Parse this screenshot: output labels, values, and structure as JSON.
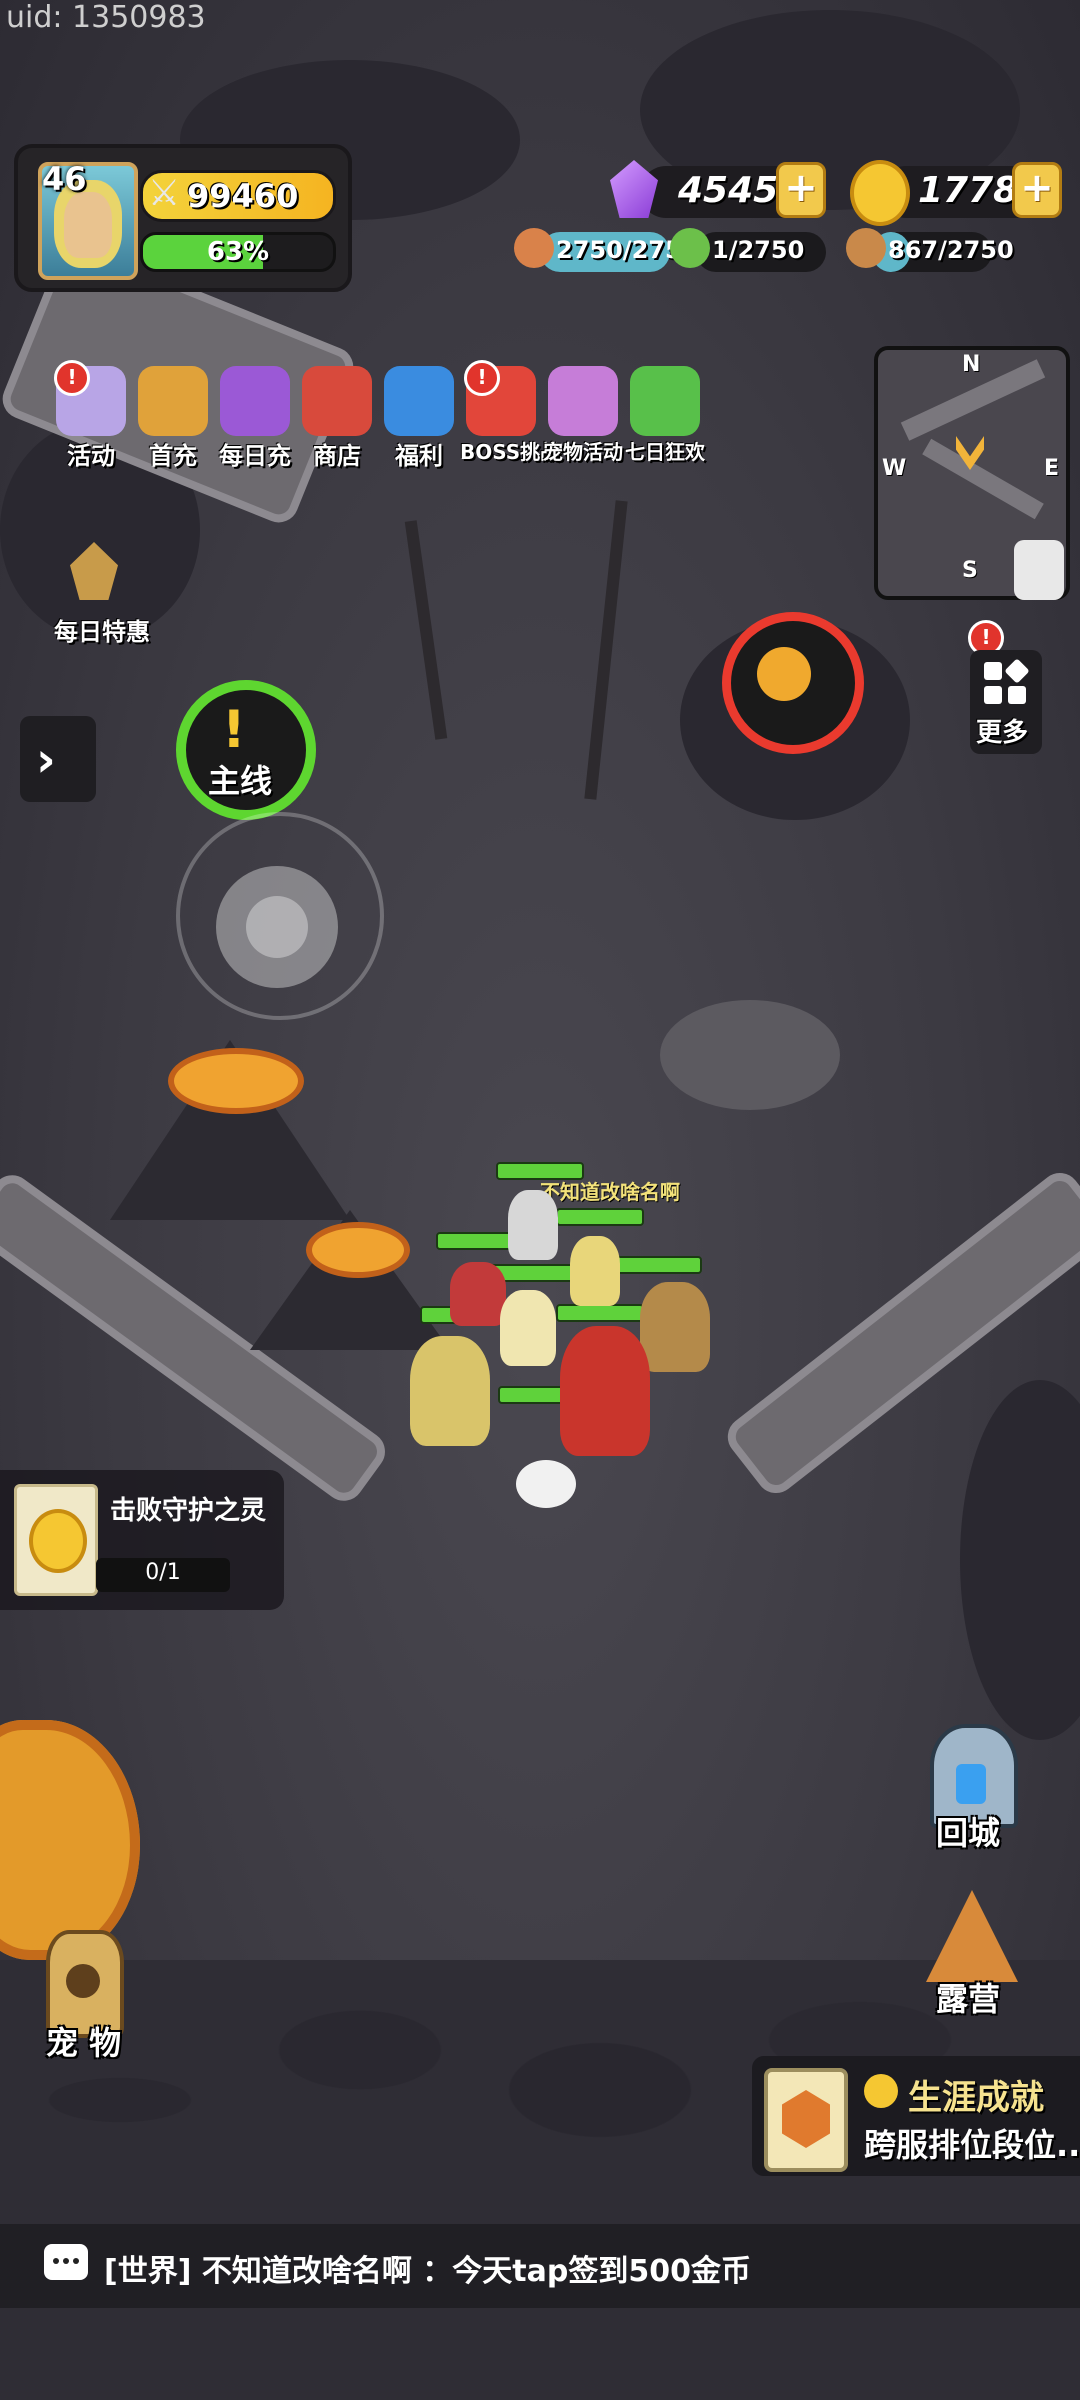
{
  "uid": "uid: 1350983",
  "player": {
    "level": "46",
    "power": "99460",
    "xp_percent": "63%",
    "xp_fraction": 0.63
  },
  "currencies": {
    "gems": "4545",
    "gold": "1778"
  },
  "resources": [
    {
      "name": "meat-icon",
      "text": "2750/2750",
      "fill": 1.0,
      "color": "#5fb7c9"
    },
    {
      "name": "herb-icon",
      "text": "1/2750",
      "fill": 0.0004,
      "color": "#5fb7c9"
    },
    {
      "name": "wood-icon",
      "text": "867/2750",
      "fill": 0.315,
      "color": "#5fb7c9"
    }
  ],
  "menu": [
    {
      "label": "活动",
      "icon": "activity-icon",
      "badge": true,
      "color": "#b8a5e6"
    },
    {
      "label": "首充",
      "icon": "first-charge-icon",
      "badge": false,
      "color": "#e0a23a"
    },
    {
      "label": "每日充",
      "icon": "daily-charge-icon",
      "badge": false,
      "color": "#9b59d6"
    },
    {
      "label": "商店",
      "icon": "shop-icon",
      "badge": false,
      "color": "#d84a3c"
    },
    {
      "label": "福利",
      "icon": "welfare-icon",
      "badge": false,
      "color": "#3a8ce0"
    },
    {
      "label": "BOSS挑战",
      "icon": "boss-challenge-icon",
      "badge": true,
      "color": "#e2463a"
    },
    {
      "label": "宠物活动",
      "icon": "pet-event-icon",
      "badge": false,
      "color": "#c67dd8"
    },
    {
      "label": "七日狂欢",
      "icon": "seven-day-icon",
      "badge": false,
      "color": "#58c04a"
    }
  ],
  "daily_deal": "每日特惠",
  "minimap": {
    "n": "N",
    "s": "S",
    "w": "W",
    "e": "E"
  },
  "more": "更多",
  "main_quest": "主线",
  "party_name": "不知道改啥名啊",
  "task": {
    "title": "击败守护之灵",
    "progress": "0/1"
  },
  "return_city": "回城",
  "camp": "露营",
  "pet": "宠 物",
  "achievement": {
    "title": "生涯成就",
    "subtitle": "跨服排位段位..."
  },
  "chat": {
    "text": "[世界] 不知道改啥名啊 ：今天tap签到500金币"
  },
  "colors": {
    "accent_green": "#5ed630",
    "boss_red": "#ea3a2e",
    "gold": "#f5c732"
  }
}
